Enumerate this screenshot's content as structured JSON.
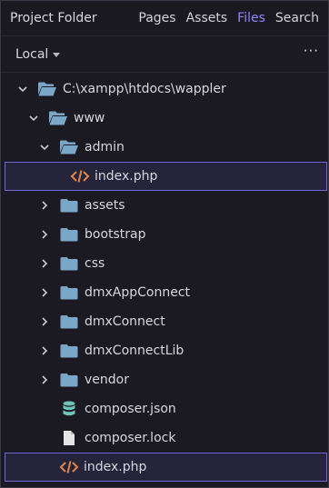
{
  "header": {
    "title": "Project Folder",
    "tabs": [
      {
        "label": "Pages"
      },
      {
        "label": "Assets"
      },
      {
        "label": "Files"
      },
      {
        "label": "Search"
      }
    ]
  },
  "toolbar": {
    "location_label": "Local",
    "more_label": "···"
  },
  "tree": {
    "items": [
      {
        "label": "C:\\xampp\\htdocs\\wappler",
        "type": "folder-open"
      },
      {
        "label": "www",
        "type": "folder-open"
      },
      {
        "label": "admin",
        "type": "folder-open"
      },
      {
        "label": "index.php",
        "type": "code-file",
        "selected": true
      },
      {
        "label": "assets",
        "type": "folder"
      },
      {
        "label": "bootstrap",
        "type": "folder"
      },
      {
        "label": "css",
        "type": "folder"
      },
      {
        "label": "dmxAppConnect",
        "type": "folder"
      },
      {
        "label": "dmxConnect",
        "type": "folder"
      },
      {
        "label": "dmxConnectLib",
        "type": "folder"
      },
      {
        "label": "vendor",
        "type": "folder"
      },
      {
        "label": "composer.json",
        "type": "database-file"
      },
      {
        "label": "composer.lock",
        "type": "plain-file"
      },
      {
        "label": "index.php",
        "type": "code-file",
        "selected": true
      }
    ]
  },
  "colors": {
    "accent": "#8f86ff",
    "folder": "#7aa7c7",
    "code_icon": "#e0864a",
    "json_icon": "#6fc3b8",
    "file_icon": "#e4e4e4"
  }
}
